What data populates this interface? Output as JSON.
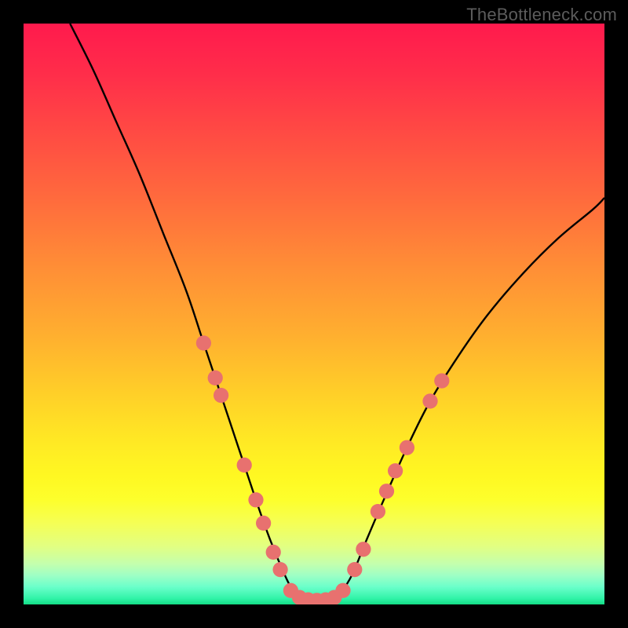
{
  "watermark": "TheBottleneck.com",
  "chart_data": {
    "type": "line",
    "title": "",
    "xlabel": "",
    "ylabel": "",
    "xlim": [
      0,
      100
    ],
    "ylim": [
      0,
      100
    ],
    "series": [
      {
        "name": "left-curve",
        "x": [
          8,
          12,
          16,
          20,
          24,
          28,
          31,
          34,
          37,
          40,
          42.5,
          45,
          47
        ],
        "y": [
          100,
          92,
          83,
          74,
          64,
          54,
          45,
          36,
          27,
          18,
          11,
          5,
          1
        ]
      },
      {
        "name": "right-curve",
        "x": [
          54,
          56.5,
          59,
          62,
          66,
          70,
          75,
          80,
          86,
          92,
          98,
          100
        ],
        "y": [
          1,
          5,
          11,
          18,
          27,
          35,
          43,
          50,
          57,
          63,
          68,
          70
        ]
      },
      {
        "name": "valley-floor",
        "x": [
          47,
          49,
          51,
          53,
          54
        ],
        "y": [
          1,
          0.4,
          0.3,
          0.4,
          1
        ]
      }
    ],
    "markers": {
      "name": "highlight-points",
      "color": "#e8716f",
      "radius_relative": 1.3,
      "points": [
        {
          "x": 31,
          "y": 45
        },
        {
          "x": 33,
          "y": 39
        },
        {
          "x": 34,
          "y": 36
        },
        {
          "x": 38,
          "y": 24
        },
        {
          "x": 40,
          "y": 18
        },
        {
          "x": 41.3,
          "y": 14
        },
        {
          "x": 43,
          "y": 9
        },
        {
          "x": 44.2,
          "y": 6
        },
        {
          "x": 46,
          "y": 2.4
        },
        {
          "x": 47.5,
          "y": 1.2
        },
        {
          "x": 49,
          "y": 0.8
        },
        {
          "x": 50.5,
          "y": 0.7
        },
        {
          "x": 52,
          "y": 0.8
        },
        {
          "x": 53.5,
          "y": 1.2
        },
        {
          "x": 55,
          "y": 2.4
        },
        {
          "x": 57,
          "y": 6
        },
        {
          "x": 58.5,
          "y": 9.5
        },
        {
          "x": 61,
          "y": 16
        },
        {
          "x": 62.5,
          "y": 19.5
        },
        {
          "x": 64,
          "y": 23
        },
        {
          "x": 66,
          "y": 27
        },
        {
          "x": 70,
          "y": 35
        },
        {
          "x": 72,
          "y": 38.5
        }
      ]
    },
    "notes": "V-shaped bottleneck curve over a vertical heat gradient (red=high bottleneck, green=optimal). No axis ticks or labels are rendered; values are relative percentages estimated from geometry."
  }
}
